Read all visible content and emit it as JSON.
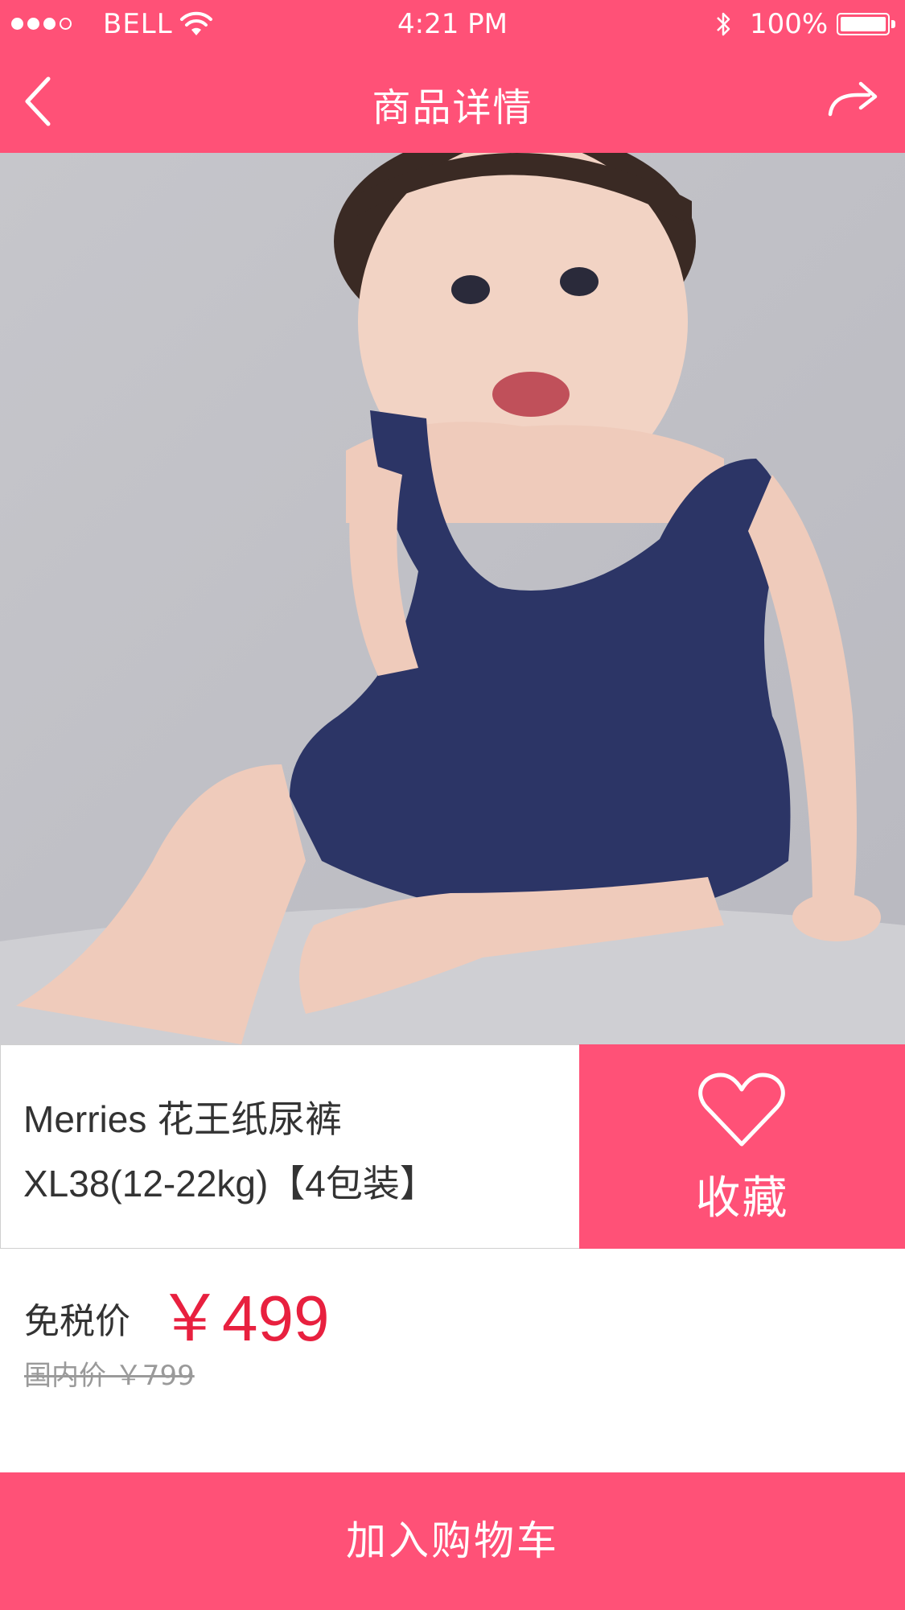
{
  "status_bar": {
    "carrier": "BELL",
    "time": "4:21 PM",
    "battery": "100%",
    "battery_level": 1.0,
    "signal_bars_filled": 3,
    "signal_bars_total": 4
  },
  "nav": {
    "title": "商品详情",
    "back_icon": "chevron-left-icon",
    "share_icon": "share-icon"
  },
  "carousel": {
    "total": 4,
    "active_indices": [
      0,
      1
    ]
  },
  "product": {
    "title_line1": "Merries 花王纸尿裤",
    "title_line2": "XL38(12-22kg)【4包装】"
  },
  "favorite": {
    "label": "收藏",
    "icon": "heart-outline-icon"
  },
  "price": {
    "label": "免税价",
    "value": "￥499",
    "domestic": "国内价 ￥799"
  },
  "actions": {
    "add_to_cart": "加入购物车"
  },
  "colors": {
    "brand": "#ff5177",
    "price": "#e8203f",
    "muted": "#9a9a9a"
  }
}
